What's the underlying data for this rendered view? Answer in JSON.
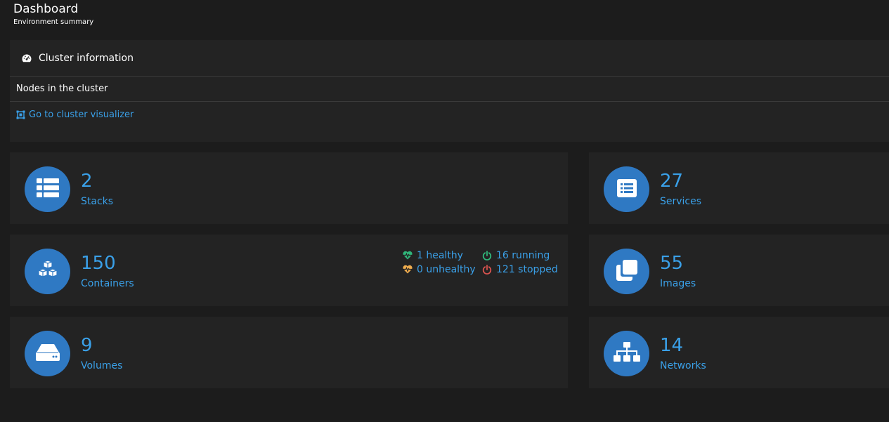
{
  "header": {
    "title": "Dashboard",
    "subtitle": "Environment summary"
  },
  "cluster": {
    "title": "Cluster information",
    "icon": "tachometer-icon",
    "nodes_label": "Nodes in the cluster",
    "visualizer_link": "Go to cluster visualizer",
    "visualizer_icon": "object-group-icon"
  },
  "tiles": {
    "stacks": {
      "count": "2",
      "label": "Stacks",
      "icon": "th-list-icon"
    },
    "services": {
      "count": "27",
      "label": "Services",
      "icon": "list-alt-icon"
    },
    "containers": {
      "count": "150",
      "label": "Containers",
      "icon": "cubes-icon"
    },
    "images": {
      "count": "55",
      "label": "Images",
      "icon": "clone-icon"
    },
    "volumes": {
      "count": "9",
      "label": "Volumes",
      "icon": "hdd-icon"
    },
    "networks": {
      "count": "14",
      "label": "Networks",
      "icon": "sitemap-icon"
    }
  },
  "container_status": {
    "healthy": "1 healthy",
    "unhealthy": "0 unhealthy",
    "running": "16 running",
    "stopped": "121 stopped"
  },
  "colors": {
    "background": "#1c1c1c",
    "panel": "#232323",
    "accent": "#3aa0e8",
    "icon_circle": "#2f79c3",
    "healthy": "#30b67a",
    "unhealthy": "#f0ad4e",
    "running": "#30b67a",
    "stopped": "#d9534f"
  }
}
